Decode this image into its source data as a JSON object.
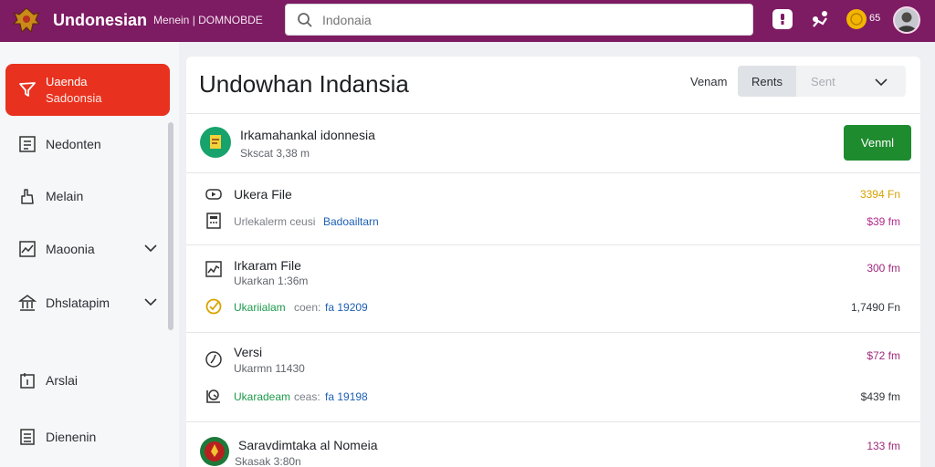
{
  "topbar": {
    "app_title": "Undonesian",
    "subtitle": "Menein | DOMNOBDE",
    "search_placeholder": "Indonaia",
    "coin_count": "65"
  },
  "sidebar": {
    "active": {
      "line1": "Uaenda",
      "line2": "Sadoonsia"
    },
    "items": [
      {
        "label": "Nedonten",
        "has_chevron": false
      },
      {
        "label": "Melain",
        "has_chevron": false
      },
      {
        "label": "Maoonia",
        "has_chevron": true
      },
      {
        "label": "Dhslatapim",
        "has_chevron": true
      },
      {
        "label": "Arslai",
        "has_chevron": false
      },
      {
        "label": "Dienenin",
        "has_chevron": false
      }
    ]
  },
  "main": {
    "title": "Undowhan Indansia",
    "control_label": "Venam",
    "segments": [
      "Rents",
      "Sent"
    ],
    "rows": [
      {
        "title": "Irkamahankal idonnesia",
        "sub": "Skscat 3,38 m",
        "button": "Venml"
      },
      {
        "title": "Ukera File",
        "amount": "3394 Fn",
        "amount_color": "#d6a100",
        "detail_label": "Urlekalerm ceusi",
        "detail_value": "Badoailtarn",
        "detail_amount": "$39 fm",
        "detail_amount_color": "#b32a8c"
      },
      {
        "title": "Irkaram File",
        "sub": "Ukarkan 1:36m",
        "amount": "300 fm",
        "amount_color": "#9e2a7c",
        "detail_label": "Ukariialam",
        "detail_mid": "coen:",
        "detail_value": "fa 19209",
        "detail_amount": "1,7490 Fn",
        "detail_amount_color": "#33373c"
      },
      {
        "title": "Versi",
        "sub": "Ukarmn 11430",
        "amount": "$72 fm",
        "amount_color": "#9e2a7c",
        "detail_label": "Ukaradeam",
        "detail_mid": "ceas:",
        "detail_value": "fa 19198",
        "detail_amount": "$439 fm",
        "detail_amount_color": "#33373c"
      },
      {
        "title": "Saravdimtaka al Nomeia",
        "sub": "Skasak 3:80n",
        "amount": "133 fm",
        "amount_color": "#9e2a7c"
      }
    ]
  }
}
